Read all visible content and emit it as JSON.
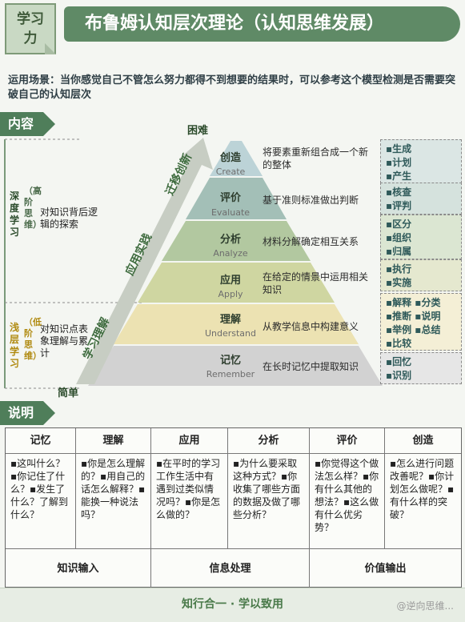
{
  "badge": {
    "line1": "学习",
    "line2": "力"
  },
  "title": "布鲁姆认知层次理论（认知思维发展）",
  "intro": "运用场景：当你感觉自己不管怎么努力都得不到想要的结果时，可以参考这个模型检测是否需要突破自己的认知层次",
  "tags": {
    "content": "内容",
    "explain": "说明"
  },
  "pyramid": {
    "top_label": "困难",
    "bottom_label": "简单",
    "levels": [
      {
        "zh": "创造",
        "en": "Create",
        "desc": "将要素重新组合成一个新的整体",
        "color": "#bcd3d7"
      },
      {
        "zh": "评价",
        "en": "Evaluate",
        "desc": "基于准则标准做出判断",
        "color": "#a3bfb7"
      },
      {
        "zh": "分析",
        "en": "Analyze",
        "desc": "材料分解确定相互关系",
        "color": "#b2c8a0"
      },
      {
        "zh": "应用",
        "en": "Apply",
        "desc": "在给定的情景中运用相关知识",
        "color": "#cfd6a1"
      },
      {
        "zh": "理解",
        "en": "Understand",
        "desc": "从教学信息中构建意义",
        "color": "#ece2b2"
      },
      {
        "zh": "记忆",
        "en": "Remember",
        "desc": "在长时记忆中提取知识",
        "color": "#d2d2d2"
      }
    ],
    "arrow_labels": {
      "a1": "学习理解",
      "a2": "应用实践",
      "a3": "迁移创新"
    }
  },
  "deep": {
    "title": "深度学习",
    "sub": "（高阶思维）",
    "desc": "对知识背后逻辑的探索"
  },
  "shallow": {
    "title": "浅层学习",
    "sub": "（低阶思维）",
    "desc": "对知识点表象理解与累计"
  },
  "verbs": [
    [
      "▪生成",
      "▪计划",
      "▪产生"
    ],
    [
      "▪核查",
      "▪评判"
    ],
    [
      "▪区分",
      "▪组织",
      "▪归属"
    ],
    [
      "▪执行",
      "▪实施"
    ],
    [
      "▪解释 ▪分类",
      "▪推断 ▪说明",
      "▪举例 ▪总结",
      "▪比较"
    ],
    [
      "▪回忆",
      "▪识别"
    ]
  ],
  "table": {
    "columns": [
      {
        "head": "记忆",
        "body": "▪这叫什么？▪你记住了什么？▪发生了什么？了解到什么？"
      },
      {
        "head": "理解",
        "body": "▪你是怎么理解的？▪用自己的话怎么解释？▪能换一种说法吗？"
      },
      {
        "head": "应用",
        "body": "▪在平时的学习工作生活中有遇到过类似情况吗？▪你是怎么做的？"
      },
      {
        "head": "分析",
        "body": "▪为什么要采取这种方式？▪你收集了哪些方面的数据及做了哪些分析？"
      },
      {
        "head": "评价",
        "body": "▪你觉得这个做法怎么样？▪你有什么其他的想法？▪这么做有什么优劣势？"
      },
      {
        "head": "创造",
        "body": "▪怎么进行问题改善呢？▪你计划怎么做呢？▪有什么样的突破？"
      }
    ],
    "bottom": [
      "知识输入",
      "信息处理",
      "价值输出"
    ]
  },
  "footer": "知行合一 · 学以致用",
  "watermark": "@逆向思维..."
}
